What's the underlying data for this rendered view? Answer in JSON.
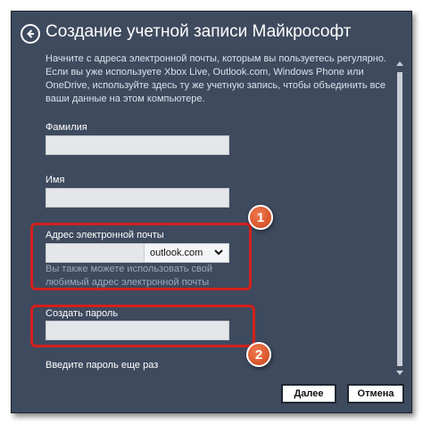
{
  "header": {
    "title": "Создание учетной записи Майкрософт"
  },
  "intro_text": "Начните с адреса электронной почты, которым вы пользуетесь регулярно. Если вы уже используете Xbox Live, Outlook.com, Windows Phone или OneDrive, используйте здесь ту же учетную запись, чтобы объединить все ваши данные на этом компьютере.",
  "form": {
    "last_name": {
      "label": "Фамилия",
      "value": ""
    },
    "first_name": {
      "label": "Имя",
      "value": ""
    },
    "email": {
      "label": "Адрес электронной почты",
      "value": "",
      "at_symbol": "@",
      "domain_selected": "outlook.com",
      "hint": "Вы также можете использовать свой любимый адрес электронной почты"
    },
    "password": {
      "label": "Создать пароль",
      "value": ""
    },
    "confirm_password": {
      "label": "Введите пароль еще раз"
    }
  },
  "annotations": {
    "badge_1": "1",
    "badge_2": "2"
  },
  "footer": {
    "next_label": "Далее",
    "cancel_label": "Отмена"
  },
  "colors": {
    "window_bg": "#3e4a5e",
    "highlight": "#d3201d",
    "badge": "#e05a2f",
    "hint_text": "#9ea9b9"
  }
}
